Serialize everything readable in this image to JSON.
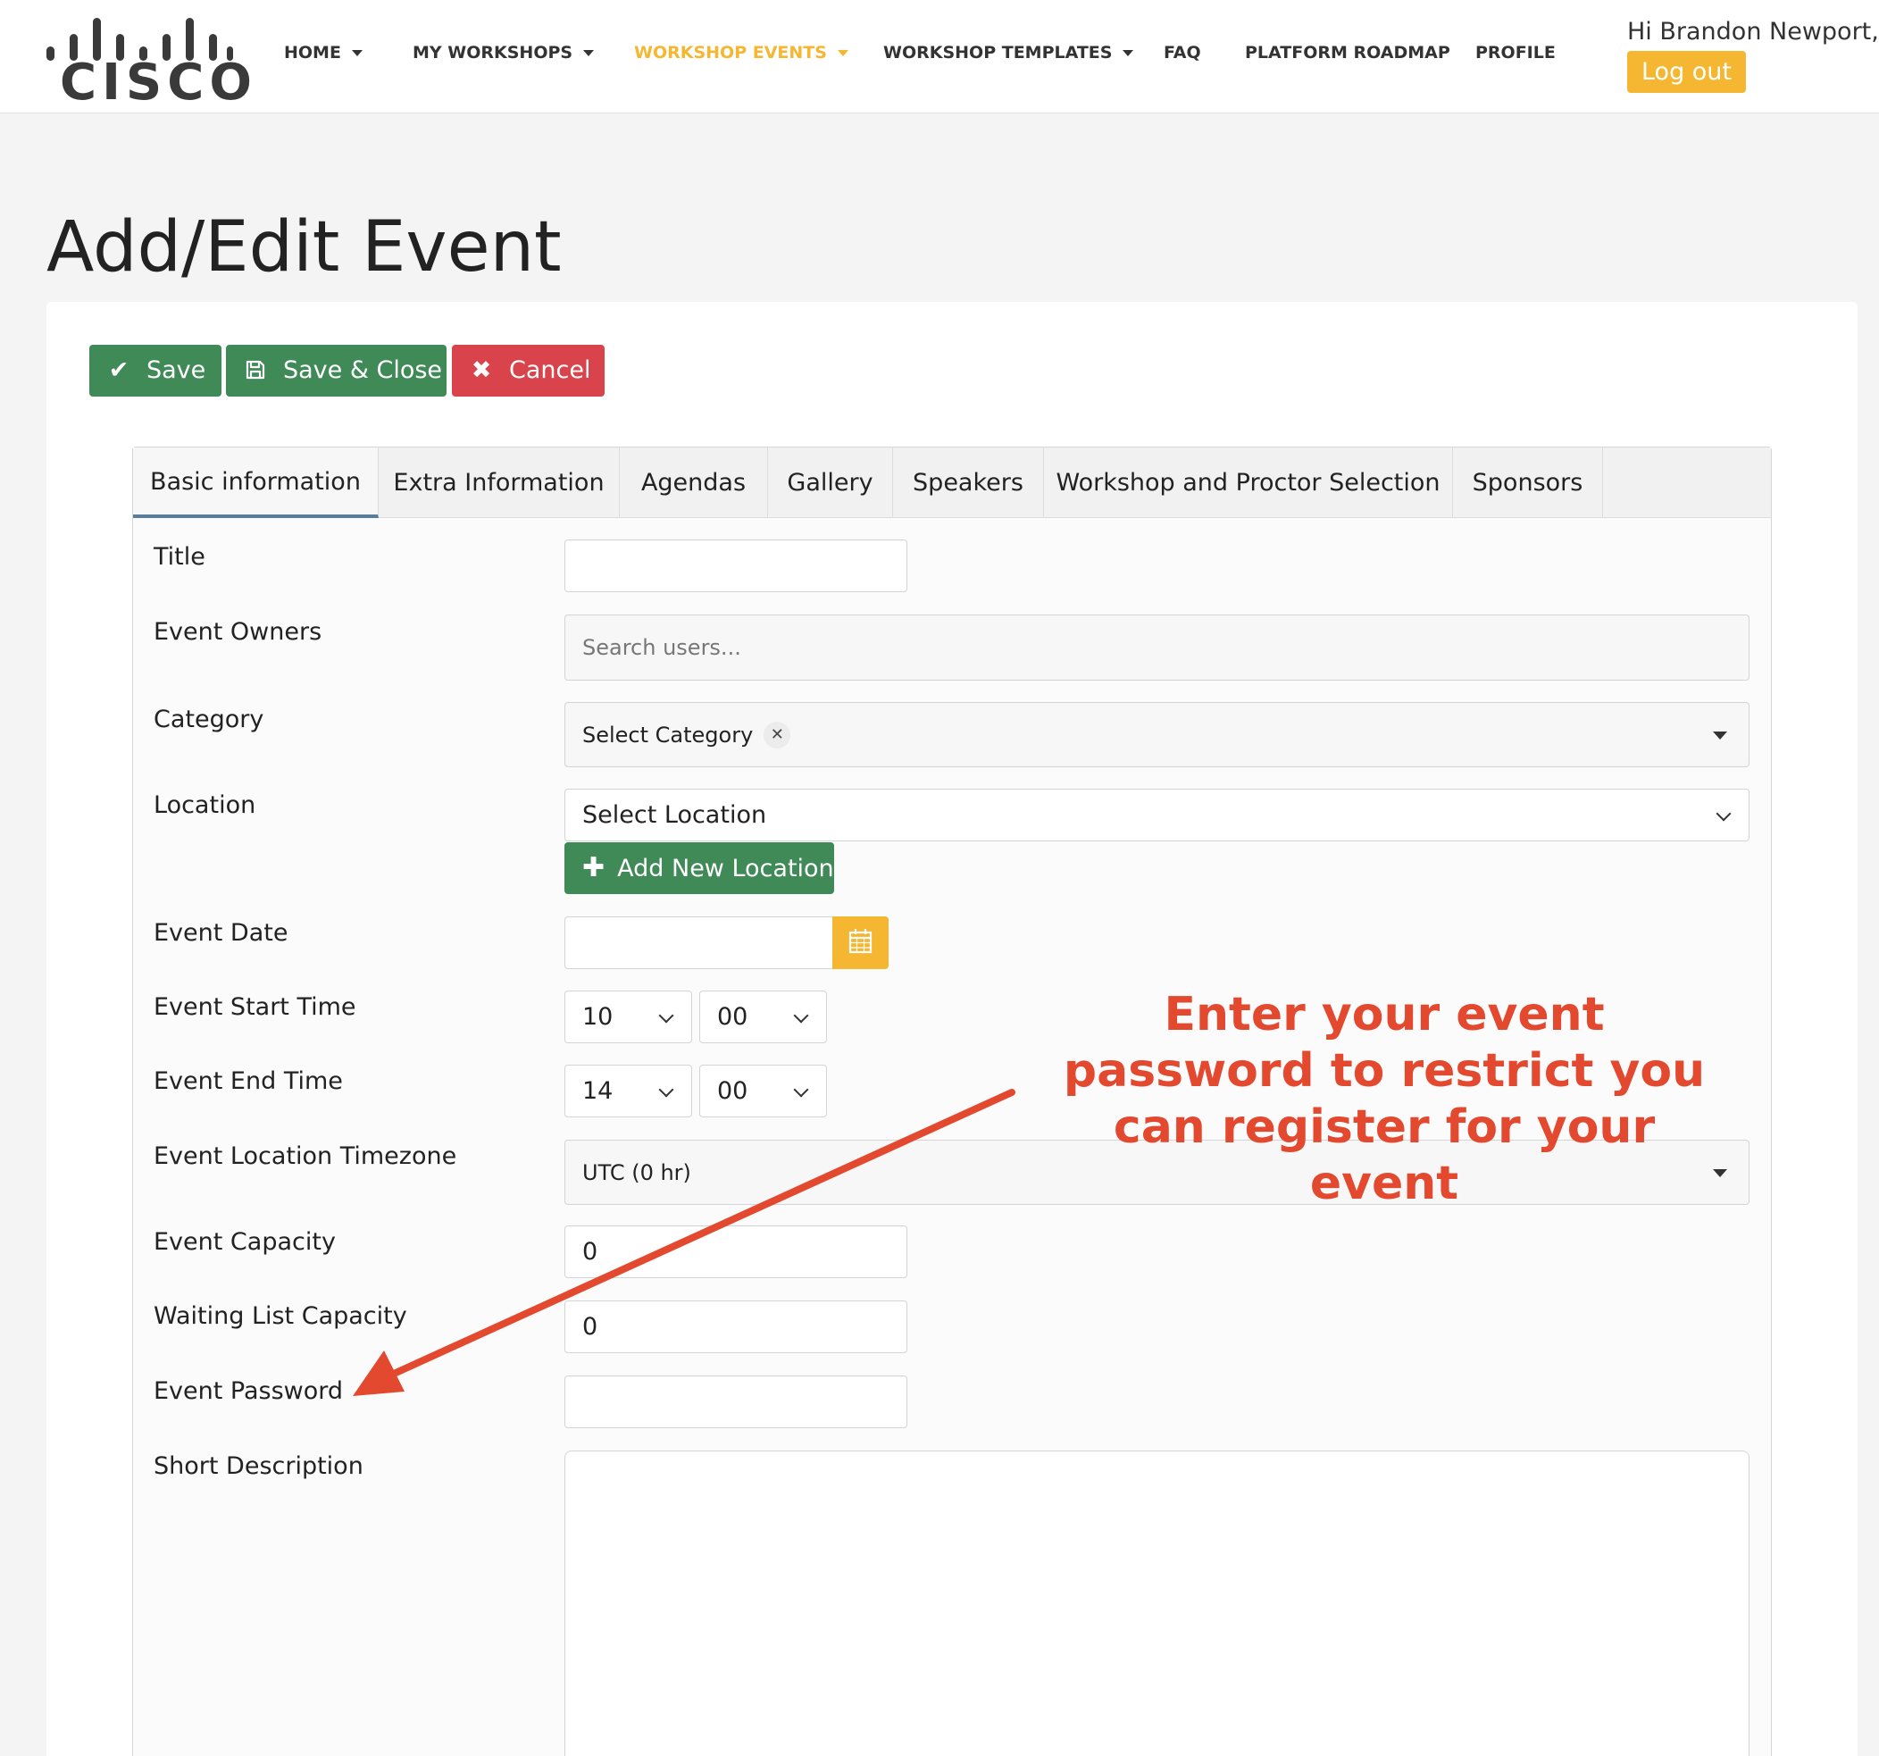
{
  "brand": {
    "logo_text": "CISCO",
    "accent": "#f5b731",
    "green": "#3f8a57",
    "red": "#d9434b"
  },
  "nav": {
    "items": [
      {
        "label": "HOME",
        "has_dropdown": true
      },
      {
        "label": "MY WORKSHOPS",
        "has_dropdown": true
      },
      {
        "label": "WORKSHOP EVENTS",
        "has_dropdown": true,
        "active": true
      },
      {
        "label": "WORKSHOP TEMPLATES",
        "has_dropdown": true
      },
      {
        "label": "FAQ",
        "has_dropdown": false
      },
      {
        "label": "PLATFORM ROADMAP",
        "has_dropdown": false
      },
      {
        "label": "PROFILE",
        "has_dropdown": false
      }
    ],
    "greeting": "Hi Brandon Newport,",
    "logout_label": "Log out"
  },
  "page": {
    "title": "Add/Edit Event"
  },
  "actions": {
    "save_label": "Save",
    "save_close_label": "Save & Close",
    "cancel_label": "Cancel"
  },
  "tabs": [
    {
      "label": "Basic information",
      "active": true
    },
    {
      "label": "Extra Information"
    },
    {
      "label": "Agendas"
    },
    {
      "label": "Gallery"
    },
    {
      "label": "Speakers"
    },
    {
      "label": "Workshop and Proctor Selection"
    },
    {
      "label": "Sponsors"
    }
  ],
  "form": {
    "title": {
      "label": "Title",
      "value": ""
    },
    "owners": {
      "label": "Event Owners",
      "placeholder": "Search users..."
    },
    "category": {
      "label": "Category",
      "value": "Select Category"
    },
    "location": {
      "label": "Location",
      "value": "Select Location",
      "add_label": "Add New Location"
    },
    "date": {
      "label": "Event Date",
      "value": ""
    },
    "start_time": {
      "label": "Event Start Time",
      "hour": "10",
      "minute": "00"
    },
    "end_time": {
      "label": "Event End Time",
      "hour": "14",
      "minute": "00"
    },
    "timezone": {
      "label": "Event Location Timezone",
      "value": "UTC (0 hr)"
    },
    "capacity": {
      "label": "Event Capacity",
      "value": "0"
    },
    "waitlist": {
      "label": "Waiting List Capacity",
      "value": "0"
    },
    "password": {
      "label": "Event Password",
      "value": ""
    },
    "short_description": {
      "label": "Short Description",
      "value": ""
    }
  },
  "annotation": {
    "text_lines": [
      "Enter your event",
      "password to restrict you",
      "can register for your",
      "event"
    ],
    "color": "#e2492f"
  }
}
